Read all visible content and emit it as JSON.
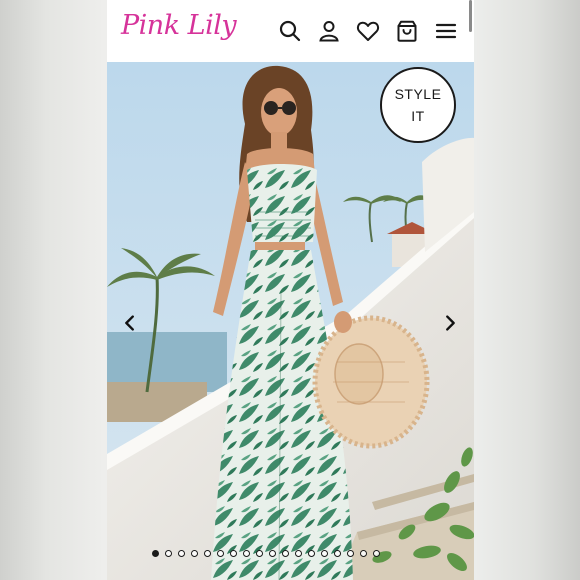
{
  "header": {
    "logo_text": "Pink Lily",
    "icons": [
      "search-icon",
      "account-icon",
      "heart-icon",
      "shopping-bag-icon",
      "menu-icon"
    ]
  },
  "hero": {
    "style_it_line1": "STYLE",
    "style_it_line2": "IT",
    "carousel": {
      "total_slides": 18,
      "active_slide": 1
    }
  },
  "colors": {
    "brand_pink": "#d6339a",
    "icon_dark": "#1a1a1a"
  }
}
